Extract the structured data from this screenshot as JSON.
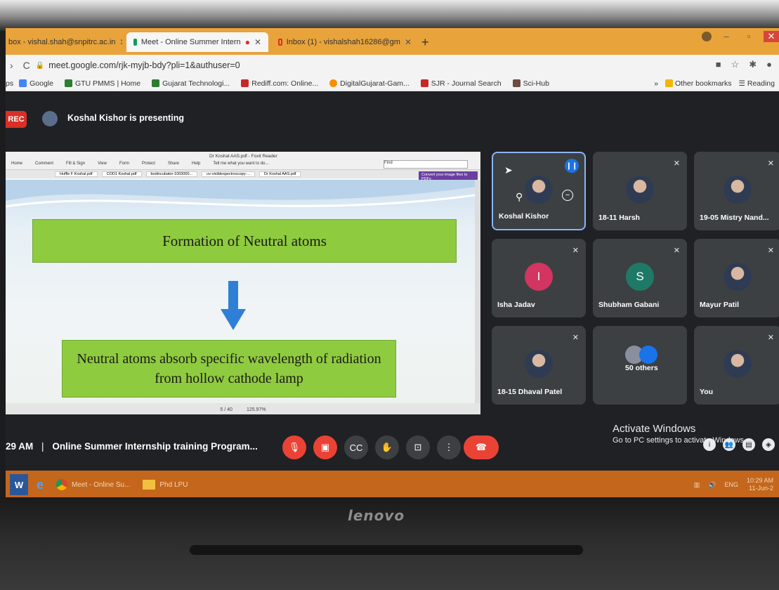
{
  "browser": {
    "tabs": [
      {
        "label": "box - vishal.shah@snpitrc.ac.in"
      },
      {
        "label": "Meet - Online Summer Intern"
      },
      {
        "label": "Inbox (1) - vishalshah16286@gm"
      }
    ],
    "new_tab": "+",
    "url": "meet.google.com/rjk-myjb-bdy?pli=1&authuser=0",
    "bookmarks": [
      {
        "label": "Google",
        "color": "#4285f4"
      },
      {
        "label": "GTU PMMS | Home",
        "color": "#2e7d32"
      },
      {
        "label": "Gujarat Technologi...",
        "color": "#2e7d32"
      },
      {
        "label": "Rediff.com: Online...",
        "color": "#c62828"
      },
      {
        "label": "DigitalGujarat-Gam...",
        "color": "#fb8c00"
      },
      {
        "label": "SJR - Journal Search",
        "color": "#c62828"
      },
      {
        "label": "Sci-Hub",
        "color": "#6d4c41"
      }
    ],
    "other_bookmarks": "Other bookmarks",
    "reading": "Reading"
  },
  "meet": {
    "rec_label": "REC",
    "presenting": "Koshal Kishor is presenting",
    "participants": [
      {
        "name": "Koshal Kishor",
        "type": "photo",
        "active": true
      },
      {
        "name": "18-11 Harsh",
        "type": "photo"
      },
      {
        "name": "19-05 Mistry Nand...",
        "type": "photo"
      },
      {
        "name": "Isha Jadav",
        "type": "letter",
        "letter": "I",
        "color": "#d23560"
      },
      {
        "name": "Shubham Gabani",
        "type": "letter",
        "letter": "S",
        "color": "#1e7a67"
      },
      {
        "name": "Mayur Patil",
        "type": "photo"
      },
      {
        "name": "18-15 Dhaval Patel",
        "type": "photo"
      },
      {
        "name": "50 others",
        "type": "group"
      },
      {
        "name": "You",
        "type": "photo"
      }
    ],
    "time": "29 AM",
    "separator": "|",
    "meeting_title": "Online Summer Internship training Program...",
    "activate_title": "Activate Windows",
    "activate_sub": "Go to PC settings to activate Windows."
  },
  "pdf": {
    "title": "Dr Koshal AAS.pdf - Foxit Reader",
    "menu": [
      "Home",
      "Comment",
      "Fill & Sign",
      "View",
      "Form",
      "Protect",
      "Share",
      "Help",
      "Tell me what you want to do..."
    ],
    "doc_tabs": [
      "Huffle F Koshal.pdf",
      "COD1 Koshal.pdf",
      "bodincubator-1003000...",
      "uv-visiblespectroscopy-...",
      "Dr Koshal AAS.pdf"
    ],
    "find": "Find",
    "convert": "Convert your image files to PDFs",
    "page_indicator": "5 / 40",
    "zoom": "125.97%"
  },
  "slide": {
    "box1": "Formation of Neutral atoms",
    "box2": "Neutral atoms absorb specific wavelength of radiation from hollow cathode lamp"
  },
  "taskbar": {
    "item_meet": "Meet - Online Su...",
    "item_phd": "Phd LPU",
    "lang": "ENG",
    "time": "10:29 AM",
    "date": "11-Jun-2"
  },
  "device": {
    "brand": "lenovo"
  },
  "colors": {
    "tabbar": "#e8a33a",
    "taskbar": "#c4661c",
    "slide_green": "#8fcb3f",
    "arrow": "#2f7fd6",
    "meet_red": "#ea4335"
  }
}
